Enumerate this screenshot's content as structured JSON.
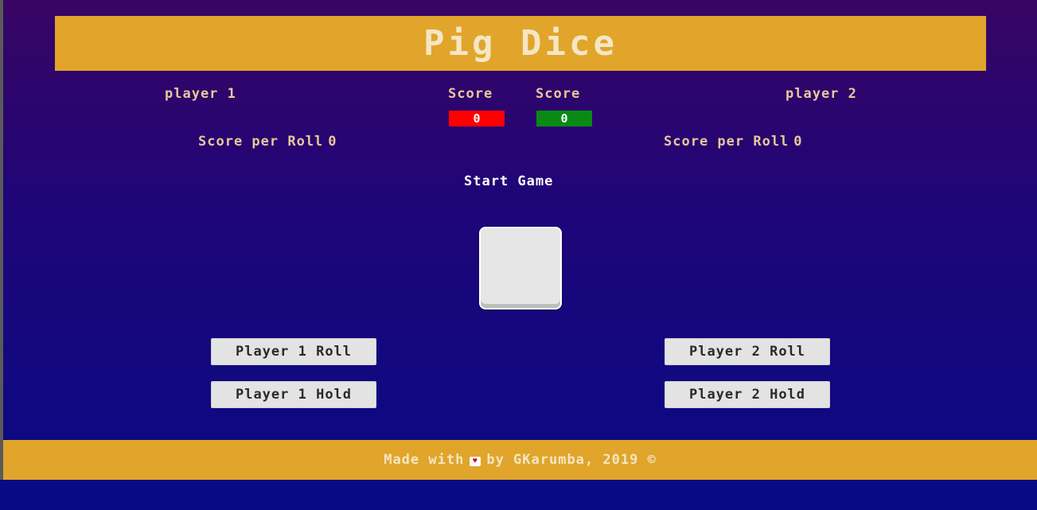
{
  "header": {
    "title": "Pig Dice"
  },
  "players": {
    "p1": {
      "name": "player 1",
      "score_label": "Score",
      "score": "0",
      "score_color": "#ff0000",
      "spr_label": "Score per Roll",
      "spr_value": "0"
    },
    "p2": {
      "name": "player 2",
      "score_label": "Score",
      "score": "0",
      "score_color": "#0a8a14",
      "spr_label": "Score per Roll",
      "spr_value": "0"
    }
  },
  "controls": {
    "start_game": "Start Game",
    "p1_roll": "Player 1 Roll",
    "p1_hold": "Player 1 Hold",
    "p2_roll": "Player 2 Roll",
    "p2_hold": "Player 2 Hold"
  },
  "die": {
    "icon": "blank-die-icon"
  },
  "footer": {
    "text_before": "Made with",
    "heart_icon": "heart-icon",
    "text_after": "by GKarumba, 2019 ©"
  },
  "colors": {
    "accent": "#e0a52a",
    "background_top": "#380563",
    "background_bottom": "#080a85"
  }
}
